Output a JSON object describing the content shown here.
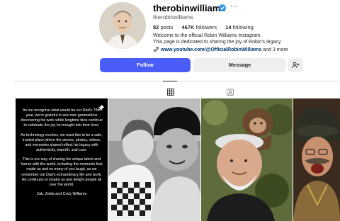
{
  "profile": {
    "username": "therobinwilliams",
    "full_name": "therobinwilliams",
    "stats": {
      "posts_count": "82",
      "posts_label": "posts",
      "followers_count": "467K",
      "followers_label": "followers",
      "following_count": "14",
      "following_label": "following"
    },
    "bio_line1": "Welcome to the official Robin Williams Instagram.",
    "bio_line2": "This page is dedicated to sharing the joy of Robin's legacy.",
    "link_text": "www.youtube.com/@OfficialRobinWilliams",
    "link_more": "and 3 more"
  },
  "actions": {
    "follow_label": "Follow",
    "message_label": "Message"
  },
  "tabs": [
    {
      "name": "posts-grid",
      "icon": "grid-icon",
      "active": true
    },
    {
      "name": "tagged",
      "icon": "tagged-icon",
      "active": false
    }
  ],
  "posts": {
    "text_post": {
      "paragraphs": [
        "As we recognize what would be our Dad's 75th year, we're grateful to see new generations discovering his work while longtime fans continue to celebrate the joy he brought into their lives.",
        "As technology evolves, we want this to be a safe, trusted place where the stories, photos, videos, and memories shared reflect his legacy with authenticity, warmth, and care.",
        "This is our way of sharing his unique talent and humor with the world, including the moments that made us and so many of you laugh, as we remember our Dad's extraordinary life and work. He continues to inspire us and delight people all over the world.",
        "Zak, Zelda and Cody Williams"
      ]
    }
  },
  "colors": {
    "follow_button": "#4a5df9",
    "secondary_button": "#efefef",
    "verified_badge": "#3897f0",
    "link": "#00376b"
  }
}
